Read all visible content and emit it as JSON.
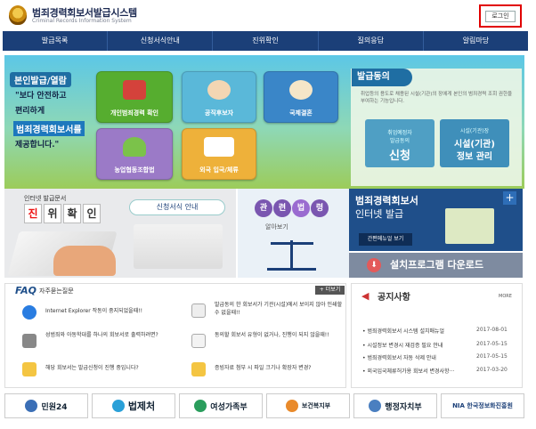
{
  "header": {
    "title": "범죄경력회보서발급시스템",
    "subtitle": "Criminal Records Information System",
    "login_label": "로그인"
  },
  "nav": [
    "발급목록",
    "신청서식안내",
    "진위확인",
    "질의응답",
    "알림마당"
  ],
  "banner": {
    "title": "본인발급/열람",
    "line1": "\"보다 안전하고",
    "line2": "편리하게",
    "highlight": "범죄경력회보서를",
    "line3": "제공합니다.\""
  },
  "tiles": [
    "개인범죄경력 확인",
    "공직후보자",
    "국제결혼",
    "농업협동조합법",
    "외국 입국/체류"
  ],
  "consent": {
    "title": "발급동의",
    "desc": "취업등의 용도로 채용된 시설(기관)의 장에게 본인의 범죄경력 조회 권한을 부여하는 기능입니다.",
    "btn1_small": "취업예정자",
    "btn1_small2": "발급동의",
    "btn1_big": "신청",
    "btn2_small": "시설(기관)장",
    "btn2_big1": "시설(기관)",
    "btn2_big2": "정보 관리"
  },
  "verify": {
    "sub": "인터넷 발급문서",
    "chars": [
      "진",
      "위",
      "확",
      "인"
    ],
    "form_guide": "신청서식 안내"
  },
  "law": {
    "chars": [
      "관",
      "련",
      "법",
      "령"
    ],
    "see": "알아보기"
  },
  "internet": {
    "title": "범죄경력회보서",
    "sub": "인터넷 발급",
    "manual": "간편메뉴얼 보기",
    "plus": "+"
  },
  "install": {
    "label": "설치프로그램 다운로드"
  },
  "faq": {
    "title": "FAQ",
    "subtitle": "자주묻는질문",
    "more": "+ 더보기",
    "items": [
      "Internet Explorer 작동이 중지되었을때!!",
      "발급동의 한 회보서가 기관(시설)에서 보이지 않아 인쇄할 수 없을때!!",
      "성범죄와 아동학대를 하나의 회보서로 출력하려면?",
      "동의할 회보서 유형이 없거나, 진행이 되지 않을때!!",
      "해당 회보서는 발급신청이 진행 중입니다?",
      "증빙자료 첨부 시 파일 크기나 확장자 변경?"
    ]
  },
  "notice": {
    "title": "공지사항",
    "more": "MORE",
    "items": [
      {
        "text": "• 범죄경력회보서 시스템 설치매뉴얼",
        "date": "2017-08-01"
      },
      {
        "text": "• 시설정보 변경시 재검증 필요 안내",
        "date": "2017-05-15"
      },
      {
        "text": "• 범죄경력회보서 자동 삭제 안내",
        "date": "2017-05-15"
      },
      {
        "text": "• 외국입국체류허가용 회보서 변경사항···",
        "date": "2017-03-20"
      }
    ]
  },
  "footer": [
    "민원24",
    "법제처",
    "여성가족부",
    "보건복지부",
    "행정자치부",
    "NIA 한국정보화진흥원"
  ]
}
